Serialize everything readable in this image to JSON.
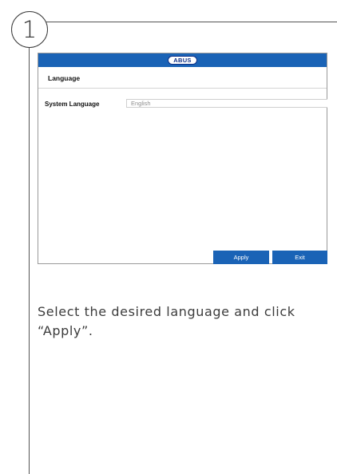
{
  "step": {
    "number": "1"
  },
  "screen": {
    "logo_text": "ABUS",
    "section_title": "Language",
    "field": {
      "label": "System Language",
      "value": "English"
    },
    "buttons": {
      "apply": "Apply",
      "exit": "Exit"
    },
    "colors": {
      "header": "#1a63b6",
      "buttons": "#1a63b6",
      "logo_border": "#0e2f86"
    }
  },
  "instruction": "Select the desired language and click “Apply”."
}
